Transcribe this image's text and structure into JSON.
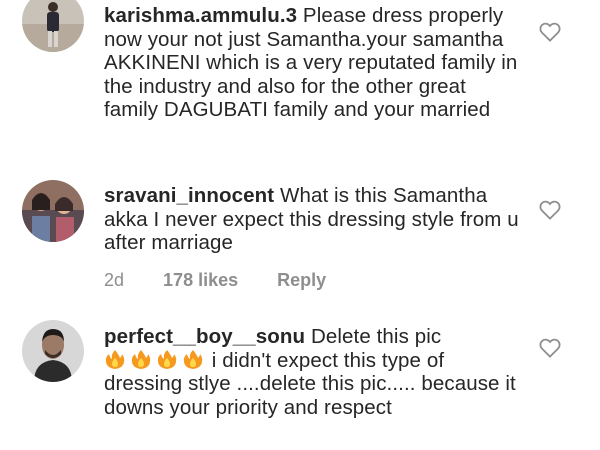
{
  "comments": [
    {
      "username": "karishma.ammulu.3",
      "text": "Please dress properly now your not just Samantha.your samantha AKKINENI which is a very reputated family in the industry and also for the other great family DAGUBATI family and your married",
      "avatar_icon": "user-avatar-standing-person",
      "heart_icon": "heart-outline-icon"
    },
    {
      "username": "sravani_innocent",
      "text": "What is this Samantha akka I never expect this dressing style from u after marriage",
      "time": "2d",
      "likes": "178 likes",
      "reply": "Reply",
      "avatar_icon": "user-avatar-group-photo",
      "heart_icon": "heart-outline-icon"
    },
    {
      "username": "perfect__boy__sonu",
      "text_before_emoji": "Delete this pic",
      "emoji": [
        "🔥",
        "🔥",
        "🔥",
        "🔥"
      ],
      "text_after_emoji": "i didn't expect this type of dressing stlye ....delete this pic..... because it downs your priority and respect",
      "avatar_icon": "user-avatar-man-portrait",
      "heart_icon": "heart-outline-icon"
    }
  ],
  "colors": {
    "text": "#262626",
    "meta": "#8e8e8e",
    "heart_outline": "#8e8e8e"
  }
}
